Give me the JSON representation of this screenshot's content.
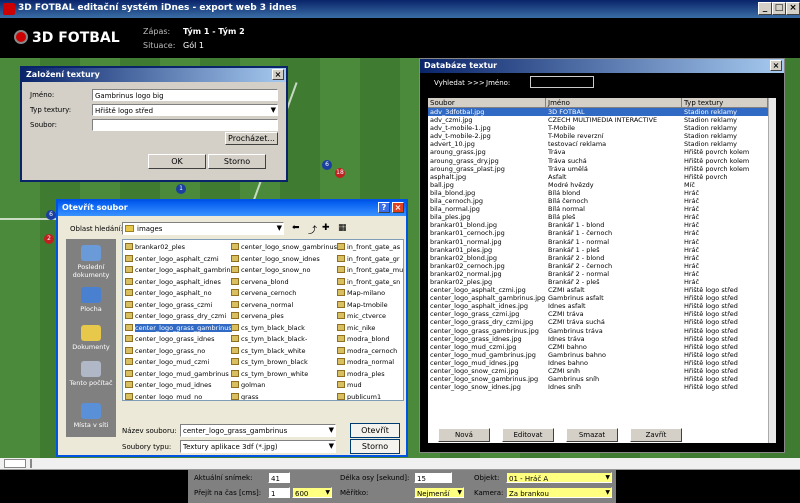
{
  "app": {
    "title": "3D FOTBAL editační systém iDnes - export web 3 idnes",
    "logo": "3D FOTBAL"
  },
  "header": {
    "zapas_label": "Zápas:",
    "zapas_value": "Tým 1 - Tým 2",
    "situace_label": "Situace:",
    "situace_value": "Gól 1"
  },
  "zalozeni": {
    "title": "Založení textury",
    "jmeno_label": "Jméno:",
    "jmeno_value": "Gambrinus logo big",
    "typ_label": "Typ textury:",
    "typ_value": "Hřiště logo střed",
    "soubor_label": "Soubor:",
    "soubor_value": "",
    "browse": "Procházet...",
    "ok": "OK",
    "storno": "Storno"
  },
  "db": {
    "title": "Databáze textur",
    "search_label": "Vyhledat >>>",
    "jmeno_label": "Jméno:",
    "search_value": "",
    "headers": [
      "Soubor",
      "Jméno",
      "Typ textury"
    ],
    "rows": [
      [
        "adv_3dfotbal.jpg",
        "3D FOTBAL",
        "Stadion reklamy"
      ],
      [
        "adv_czmi.jpg",
        "CZECH MULTIMEDIA INTERACTIVE",
        "Stadion reklamy"
      ],
      [
        "adv_t-mobile-1.jpg",
        "T-Mobile",
        "Stadion reklamy"
      ],
      [
        "adv_t-mobile-2.jpg",
        "T-Mobile reverzní",
        "Stadion reklamy"
      ],
      [
        "advert_10.jpg",
        "testovací reklama",
        "Stadion reklamy"
      ],
      [
        "aroung_grass.jpg",
        "Tráva",
        "Hřiště povrch kolem"
      ],
      [
        "aroung_grass_dry.jpg",
        "Tráva suchá",
        "Hřiště povrch kolem"
      ],
      [
        "aroung_grass_plast.jpg",
        "Tráva umělá",
        "Hřiště povrch kolem"
      ],
      [
        "asphalt.jpg",
        "Asfalt",
        "Hřiště povrch"
      ],
      [
        "ball.jpg",
        "Modré hvězdy",
        "Míč"
      ],
      [
        "bila_blond.jpg",
        "Bílá blond",
        "Hráč"
      ],
      [
        "bila_cernoch.jpg",
        "Bílá černoch",
        "Hráč"
      ],
      [
        "bila_normal.jpg",
        "Bílá normal",
        "Hráč"
      ],
      [
        "bila_ples.jpg",
        "Bílá pleš",
        "Hráč"
      ],
      [
        "brankar01_blond.jpg",
        "Brankář 1 - blond",
        "Hráč"
      ],
      [
        "brankar01_cernoch.jpg",
        "Brankář 1 - černoch",
        "Hráč"
      ],
      [
        "brankar01_normal.jpg",
        "Brankář 1 - normal",
        "Hráč"
      ],
      [
        "brankar01_ples.jpg",
        "Brankář 1 - pleš",
        "Hráč"
      ],
      [
        "brankar02_blond.jpg",
        "Brankář 2 - blond",
        "Hráč"
      ],
      [
        "brankar02_cernoch.jpg",
        "Brankář 2 - černoch",
        "Hráč"
      ],
      [
        "brankar02_normal.jpg",
        "Brankář 2 - normal",
        "Hráč"
      ],
      [
        "brankar02_ples.jpg",
        "Brankář 2 - pleš",
        "Hráč"
      ],
      [
        "center_logo_asphalt_czmi.jpg",
        "CZMI asfalt",
        "Hřiště logo střed"
      ],
      [
        "center_logo_asphalt_gambrinus.jpg",
        "Gambrinus asfalt",
        "Hřiště logo střed"
      ],
      [
        "center_logo_asphalt_idnes.jpg",
        "Idnes asfalt",
        "Hřiště logo střed"
      ],
      [
        "center_logo_grass_czmi.jpg",
        "CZMI tráva",
        "Hřiště logo střed"
      ],
      [
        "center_logo_grass_dry_czmi.jpg",
        "CZMI tráva suchá",
        "Hřiště logo střed"
      ],
      [
        "center_logo_grass_gambrinus.jpg",
        "Gambrinus tráva",
        "Hřiště logo střed"
      ],
      [
        "center_logo_grass_idnes.jpg",
        "Idnes tráva",
        "Hřiště logo střed"
      ],
      [
        "center_logo_mud_czmi.jpg",
        "CZMI bahno",
        "Hřiště logo střed"
      ],
      [
        "center_logo_mud_gambrinus.jpg",
        "Gambrinus bahno",
        "Hřiště logo střed"
      ],
      [
        "center_logo_mud_idnes.jpg",
        "Idnes bahno",
        "Hřiště logo střed"
      ],
      [
        "center_logo_snow_czmi.jpg",
        "CZMI sníh",
        "Hřiště logo střed"
      ],
      [
        "center_logo_snow_gambrinus.jpg",
        "Gambrinus sníh",
        "Hřiště logo střed"
      ],
      [
        "center_logo_snow_idnes.jpg",
        "Idnes sníh",
        "Hřiště logo střed"
      ]
    ],
    "buttons": [
      "Nová",
      "Editovat",
      "Smazat",
      "Zavřít"
    ]
  },
  "filedlg": {
    "title": "Otevřít soubor",
    "oblast_label": "Oblast hledání:",
    "folder": "images",
    "places": [
      "Poslední dokumenty",
      "Plocha",
      "Dokumenty",
      "Tento počítač",
      "Místa v síti"
    ],
    "files_col1": [
      "brankar02_ples",
      "center_logo_asphalt_czmi",
      "center_logo_asphalt_gambrin",
      "center_logo_asphalt_idnes",
      "center_logo_asphalt_no",
      "center_logo_grass_czmi",
      "center_logo_grass_dry_czmi",
      "center_logo_grass_gambrinus",
      "center_logo_grass_idnes",
      "center_logo_grass_no",
      "center_logo_mud_czmi",
      "center_logo_mud_gambrinus",
      "center_logo_mud_idnes",
      "center_logo_mud_no",
      "center_logo_snow_czmi"
    ],
    "files_col2": [
      "center_logo_snow_gambrinus",
      "center_logo_snow_idnes",
      "center_logo_snow_no",
      "cervena_blond",
      "cervena_cernoch",
      "cervena_normal",
      "cervena_ples",
      "cs_tym_black_black",
      "cs_tym_black_black-",
      "cs_tym_black_white",
      "cs_tym_brown_black",
      "cs_tym_brown_white",
      "golman",
      "grass",
      "grass_dry"
    ],
    "files_col3": [
      "in_front_gate_as",
      "in_front_gate_gr",
      "in_front_gate_mu",
      "in_front_gate_sn",
      "Map-milano",
      "Map-tmobile",
      "mic_ctverce",
      "mic_nike",
      "modra_blond",
      "modra_cernoch",
      "modra_normal",
      "modra_ples",
      "mud",
      "publicum1",
      "publicum2"
    ],
    "selected": "center_logo_grass_gambrinus",
    "nazev_label": "Název souboru:",
    "nazev_value": "center_logo_grass_gambrinus",
    "typ_label": "Soubory typu:",
    "typ_value": "Textury aplikace 3df (*.jpg)",
    "open": "Otevřít",
    "cancel": "Storno"
  },
  "bottom": {
    "aktualni_label": "Aktuální snímek:",
    "aktualni_value": "41",
    "prejit_label": "Přejít na čas [cms]:",
    "prejit_value": "1",
    "prejit_value2": "600",
    "delka_label": "Délka osy [sekund]:",
    "delka_value": "15",
    "meritko_label": "Měřítko:",
    "meritko_value": "Nejmenší",
    "objekt_label": "Objekt:",
    "objekt_value": "01 - Hráč A",
    "kamera_label": "Kamera:",
    "kamera_value": "Za brankou"
  }
}
